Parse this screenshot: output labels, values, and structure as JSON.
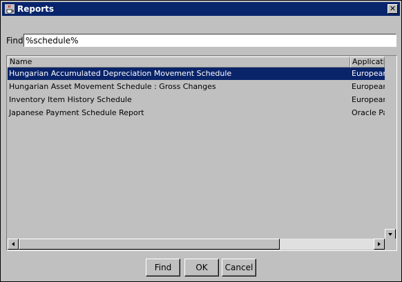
{
  "window": {
    "title": "Reports",
    "close_label": "✕"
  },
  "find": {
    "label": "Find",
    "value": "%schedule%"
  },
  "table": {
    "columns": [
      "Name",
      "Applicatio"
    ],
    "rows": [
      {
        "name": "Hungarian Accumulated Depreciation Movement Schedule",
        "app": "European",
        "selected": true
      },
      {
        "name": "Hungarian Asset Movement Schedule : Gross Changes",
        "app": "European",
        "selected": false
      },
      {
        "name": "Inventory Item History Schedule",
        "app": "European",
        "selected": false
      },
      {
        "name": "Japanese Payment Schedule Report",
        "app": "Oracle Pa",
        "selected": false
      }
    ]
  },
  "buttons": {
    "find": "Find",
    "ok": "OK",
    "cancel": "Cancel"
  },
  "colors": {
    "titlebar": "#08246b",
    "selection": "#0a246a",
    "panel": "#c0c0c0"
  }
}
